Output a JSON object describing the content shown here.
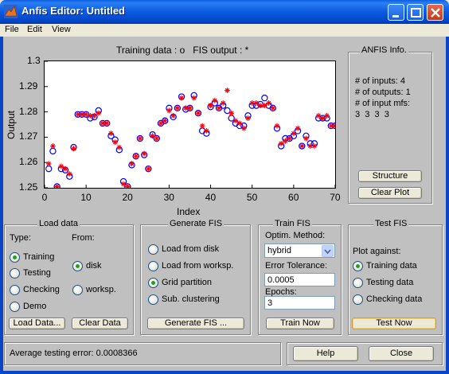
{
  "window": {
    "title": "Anfis Editor: Untitled"
  },
  "menu": [
    "File",
    "Edit",
    "View"
  ],
  "plot": {
    "title": "Training data : o   FIS output : *",
    "xlabel": "Index",
    "ylabel": "Output"
  },
  "chart_data": {
    "type": "scatter",
    "title": "Training data : o   FIS output : *",
    "xlabel": "Index",
    "ylabel": "Output",
    "xlim": [
      0,
      70
    ],
    "ylim": [
      1.25,
      1.3
    ],
    "xticks": [
      "0",
      "10",
      "20",
      "30",
      "40",
      "50",
      "60",
      "70"
    ],
    "yticks": [
      "1.25",
      "1.26",
      "1.27",
      "1.28",
      "1.29",
      "1.3"
    ],
    "series": [
      {
        "marker": "circle",
        "color": "#0000ff",
        "x": [
          1,
          2,
          3,
          4,
          5,
          6,
          7,
          8,
          9,
          10,
          11,
          12,
          13,
          14,
          15,
          16,
          17,
          18,
          19,
          20,
          21,
          22,
          23,
          24,
          25,
          26,
          27,
          28,
          29,
          30,
          31,
          32,
          33,
          34,
          35,
          36,
          37,
          38,
          39,
          40,
          41,
          42,
          43,
          44,
          45,
          46,
          47,
          48,
          49,
          50,
          51,
          52,
          53,
          54,
          55,
          56,
          57,
          58,
          59,
          60,
          61,
          62,
          63,
          64,
          65,
          66,
          67,
          68,
          69,
          70
        ],
        "y": [
          1.2575,
          1.2645,
          1.2505,
          1.2575,
          1.257,
          1.2545,
          1.266,
          1.279,
          1.279,
          1.279,
          1.2775,
          1.278,
          1.2805,
          1.2755,
          1.2755,
          1.2705,
          1.269,
          1.265,
          1.2525,
          1.2505,
          1.259,
          1.2625,
          1.2695,
          1.263,
          1.2575,
          1.271,
          1.2695,
          1.2755,
          1.2765,
          1.2815,
          1.278,
          1.2815,
          1.286,
          1.281,
          1.2815,
          1.2865,
          1.2795,
          1.2725,
          1.2715,
          1.282,
          1.2835,
          1.2815,
          1.2825,
          1.2805,
          1.2775,
          1.2755,
          1.2745,
          1.2745,
          1.2785,
          1.2825,
          1.2825,
          1.283,
          1.2855,
          1.2825,
          1.2815,
          1.2735,
          1.2665,
          1.2695,
          1.2695,
          1.2705,
          1.2725,
          1.2665,
          1.2705,
          1.2675,
          1.2675,
          1.2775,
          1.2775,
          1.2775,
          1.2745,
          1.2745
        ]
      },
      {
        "marker": "star",
        "color": "#ff0000",
        "x": [
          1,
          2,
          3,
          4,
          5,
          6,
          7,
          8,
          9,
          10,
          11,
          12,
          13,
          14,
          15,
          16,
          17,
          18,
          19,
          20,
          21,
          22,
          23,
          24,
          25,
          26,
          27,
          28,
          29,
          30,
          31,
          32,
          33,
          34,
          35,
          36,
          37,
          38,
          39,
          40,
          41,
          42,
          43,
          44,
          45,
          46,
          47,
          48,
          49,
          50,
          51,
          52,
          53,
          54,
          55,
          56,
          57,
          58,
          59,
          60,
          61,
          62,
          63,
          64,
          65,
          66,
          67,
          68,
          69,
          70
        ],
        "y": [
          1.2595,
          1.2665,
          1.2505,
          1.2585,
          1.2575,
          1.2555,
          1.2655,
          1.279,
          1.279,
          1.279,
          1.2785,
          1.2785,
          1.2795,
          1.2755,
          1.2755,
          1.2715,
          1.268,
          1.266,
          1.2515,
          1.2505,
          1.2595,
          1.2625,
          1.2695,
          1.2635,
          1.2575,
          1.2705,
          1.2695,
          1.2755,
          1.2765,
          1.2805,
          1.2785,
          1.2815,
          1.2855,
          1.2815,
          1.2815,
          1.2855,
          1.2795,
          1.2745,
          1.2725,
          1.2825,
          1.2845,
          1.2815,
          1.2835,
          1.2885,
          1.2795,
          1.2765,
          1.2755,
          1.2735,
          1.2775,
          1.2835,
          1.2835,
          1.2825,
          1.2825,
          1.2835,
          1.2815,
          1.2745,
          1.2675,
          1.2685,
          1.2695,
          1.2715,
          1.2735,
          1.2665,
          1.2695,
          1.2665,
          1.2665,
          1.2785,
          1.2775,
          1.2785,
          1.2745,
          1.2745
        ]
      }
    ]
  },
  "anfis_info": {
    "title": "ANFIS Info.",
    "inputs": "# of inputs: 4",
    "outputs": "# of outputs: 1",
    "mfs": "# of input mfs:",
    "mfs_values": "3  3  3  3",
    "structure_button": "Structure",
    "clear_plot_button": "Clear Plot"
  },
  "load_data": {
    "title": "Load data",
    "type_label": "Type:",
    "from_label": "From:",
    "types": [
      "Training",
      "Testing",
      "Checking",
      "Demo"
    ],
    "selected_type": "Training",
    "sources": [
      "disk",
      "worksp."
    ],
    "selected_source": "disk",
    "load_button": "Load Data...",
    "clear_button": "Clear Data"
  },
  "generate_fis": {
    "title": "Generate FIS",
    "options": [
      "Load from disk",
      "Load from worksp.",
      "Grid partition",
      "Sub. clustering"
    ],
    "selected": "Grid partition",
    "button": "Generate FIS ..."
  },
  "train_fis": {
    "title": "Train FIS",
    "method_label": "Optim. Method:",
    "method_value": "hybrid",
    "tolerance_label": "Error Tolerance:",
    "tolerance_value": "0.0005",
    "epochs_label": "Epochs:",
    "epochs_value": "3",
    "button": "Train Now"
  },
  "test_fis": {
    "title": "Test FIS",
    "plot_against_label": "Plot against:",
    "options": [
      "Training data",
      "Testing data",
      "Checking data"
    ],
    "selected": "Training data",
    "button": "Test Now"
  },
  "status": {
    "text": "Average testing error: 0.0008366",
    "help_button": "Help",
    "close_button": "Close"
  }
}
